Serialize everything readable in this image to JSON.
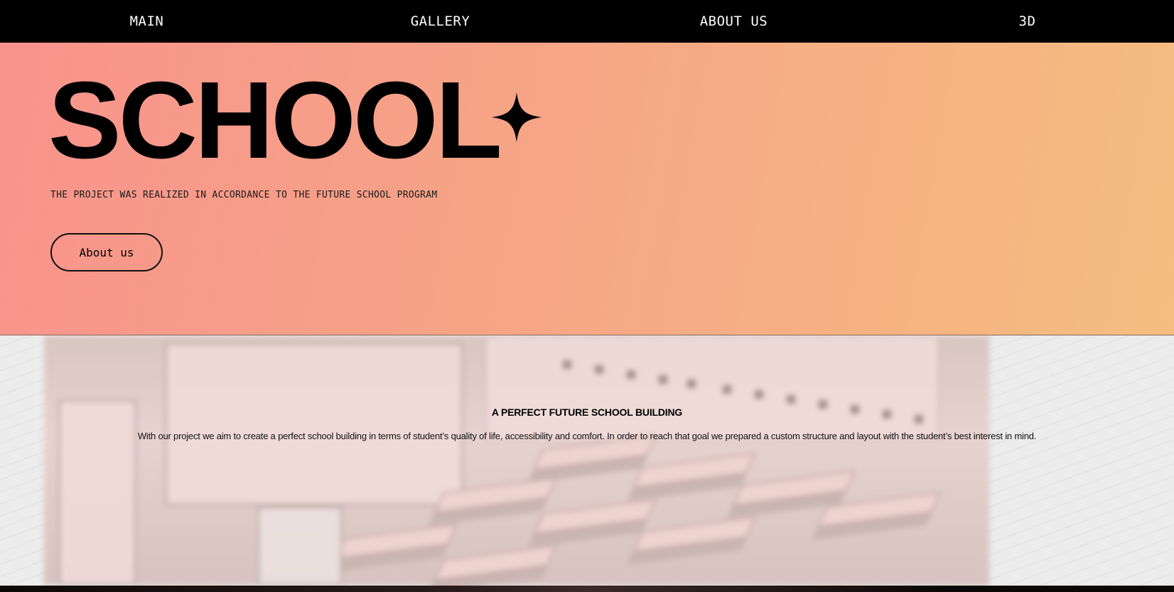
{
  "nav": {
    "items": [
      {
        "label": "MAIN"
      },
      {
        "label": "GALLERY"
      },
      {
        "label": "ABOUT US"
      },
      {
        "label": "3D"
      }
    ]
  },
  "hero": {
    "title": "SCHOOL",
    "icon": "sparkle-icon",
    "subtitle": "THE PROJECT WAS REALIZED IN ACCORDANCE TO THE FUTURE SCHOOL PROGRAM",
    "button_label": "About us",
    "gradient_start": "#f8938c",
    "gradient_end": "#f5bd7f"
  },
  "section": {
    "heading": "A PERFECT FUTURE SCHOOL BUILDING",
    "body": "With our project we aim to create a perfect school building in terms of student’s quality of life, accessibility and comfort. In order to reach that goal we prepared a custom structure and layout with the student’s best interest in mind."
  }
}
